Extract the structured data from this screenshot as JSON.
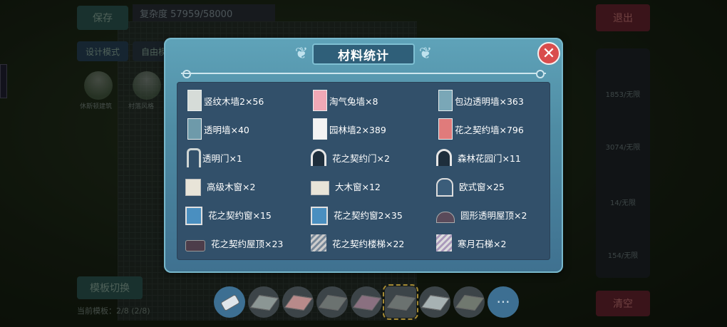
{
  "background": {
    "save_label": "保存",
    "complexity": "复杂度 57959/58000",
    "design_mode_label": "设计模式",
    "free_mode_label": "自由模",
    "exit_label": "退出",
    "clear_label": "清空",
    "switch_label": "模板切换",
    "bottom_hint": "当前模板：2/8 (2/8)",
    "side_counts": [
      "1853/无限",
      "3074/无限",
      "14/无限",
      "154/无限"
    ],
    "thumb_labels": [
      "休斯顿建筑",
      "村落风格"
    ]
  },
  "dialog": {
    "title": "材料统计",
    "close_icon": "close-icon",
    "items": [
      {
        "label": "竖纹木墙2×56",
        "icon": "wall-icon",
        "icon_color": "#d6dcd8"
      },
      {
        "label": "淘气兔墙×8",
        "icon": "wall-icon",
        "icon_color": "#f0a8b6"
      },
      {
        "label": "包边透明墙×363",
        "icon": "wall-icon",
        "icon_color": "#7aa7b7"
      },
      {
        "label": "透明墙×40",
        "icon": "wall-icon",
        "icon_color": "#6e9aaa"
      },
      {
        "label": "园林墙2×389",
        "icon": "wall-icon",
        "icon_color": "#f3f3f3"
      },
      {
        "label": "花之契约墙×796",
        "icon": "wall-icon",
        "icon_color": "#e07b7b"
      },
      {
        "label": "透明门×1",
        "icon": "door-icon"
      },
      {
        "label": "花之契约门×2",
        "icon": "flower-door-icon"
      },
      {
        "label": "森林花园门×11",
        "icon": "arch-door-icon"
      },
      {
        "label": "高级木窗×2",
        "icon": "window-icon"
      },
      {
        "label": "大木窗×12",
        "icon": "window-icon"
      },
      {
        "label": "欧式窗×25",
        "icon": "arch-window-icon"
      },
      {
        "label": "花之契约窗×15",
        "icon": "blue-window-icon"
      },
      {
        "label": "花之契约窗2×35",
        "icon": "blue-window-icon"
      },
      {
        "label": "圆形透明屋顶×2",
        "icon": "dome-roof-icon"
      },
      {
        "label": "花之契约屋顶×23",
        "icon": "roof-icon"
      },
      {
        "label": "花之契约楼梯×22",
        "icon": "stairs-icon"
      },
      {
        "label": "寒月石梯×2",
        "icon": "stairs-icon"
      }
    ]
  },
  "hotbar": {
    "slots": [
      "eraser-icon",
      "floor-tile-icon",
      "floor-tile-icon",
      "floor-tile-icon",
      "floor-tile-icon",
      "floor-tile-icon",
      "floor-tile-icon",
      "floor-tile-icon",
      "more-icon"
    ],
    "selected_index": 5,
    "more_label": "···"
  }
}
